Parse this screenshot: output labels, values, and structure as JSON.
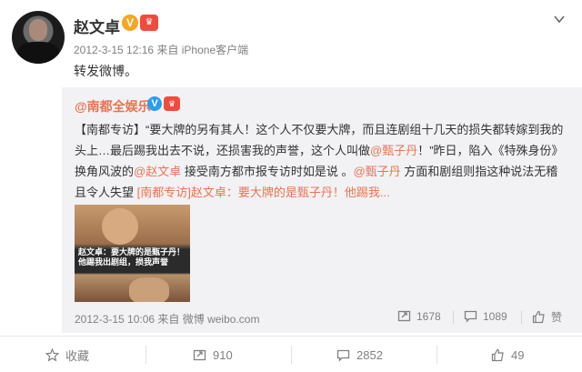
{
  "post": {
    "author": "赵文卓",
    "verified_badge": "V",
    "member_badge": "♛",
    "timestamp": "2012-3-15 12:16",
    "source": "来自 iPhone客户端",
    "text": "转发微博。"
  },
  "repost": {
    "author": "@南都全娱乐",
    "verified_badge": "V",
    "member_badge": "♛",
    "body": {
      "part1": "【南都专访】“要大牌的另有其人！这个人不仅要大牌，而且连剧组十几天的损失都转嫁到我的头上…最后踢我出去不说，还损害我的声誉，这个人叫做",
      "mention1": "@甄子丹",
      "part2": "！”昨日，陷入《特殊身份》换角风波的",
      "mention2": "@赵文卓",
      "part3": " 接受南方都市报专访时如是说 。",
      "mention3": "@甄子丹",
      "part4": " 方面和剧组则指这种说法无稽且令人失望 ",
      "link": "[南都专访]赵文卓：要大牌的是甄子丹！他踢我..."
    },
    "image_caption": "赵文卓：要大牌的是甄子丹！他踢我出剧组，损我声誉",
    "timestamp": "2012-3-15 10:06",
    "source": "来自 微博 weibo.com",
    "repost_count": "1678",
    "comment_count": "1089",
    "like_label": "赞"
  },
  "footer": {
    "favorite_label": "收藏",
    "repost_count": "910",
    "comment_count": "2852",
    "like_count": "49"
  },
  "colors": {
    "link": "#eb7350",
    "meta": "#808080",
    "repost_bg": "#f2f2f5"
  }
}
